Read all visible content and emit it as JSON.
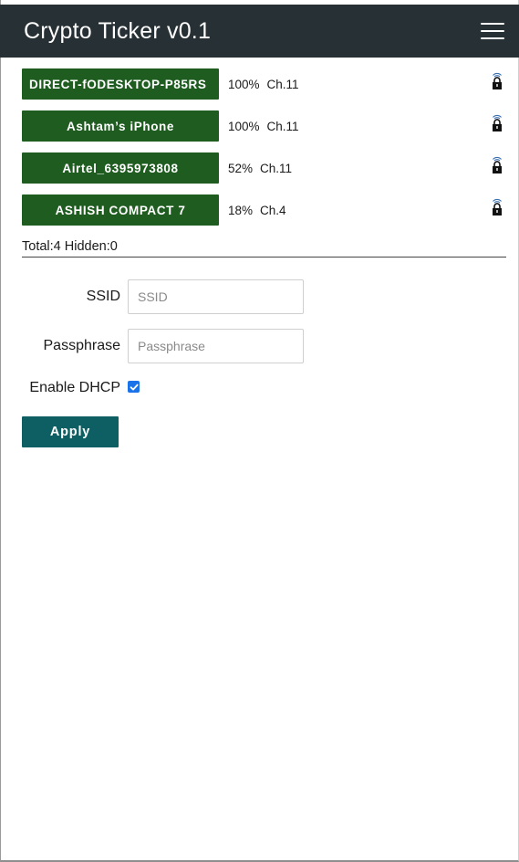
{
  "app": {
    "title": "Crypto Ticker v0.1"
  },
  "networks": [
    {
      "ssid": "DIRECT-fODESKTOP-P85RS",
      "signal": "100%",
      "channel": "Ch.11",
      "secured": true
    },
    {
      "ssid": "Ashtam’s iPhone",
      "signal": "100%",
      "channel": "Ch.11",
      "secured": true
    },
    {
      "ssid": "Airtel_6395973808",
      "signal": "52%",
      "channel": "Ch.11",
      "secured": true
    },
    {
      "ssid": "ASHISH COMPACT 7",
      "signal": "18%",
      "channel": "Ch.4",
      "secured": true
    }
  ],
  "summary": {
    "text": "Total:4 Hidden:0"
  },
  "form": {
    "ssid_label": "SSID",
    "ssid_placeholder": "SSID",
    "ssid_value": "",
    "pass_label": "Passphrase",
    "pass_placeholder": "Passphrase",
    "pass_value": "",
    "dhcp_label": "Enable DHCP",
    "dhcp_checked": true,
    "apply_label": "Apply"
  },
  "colors": {
    "topbar": "#273035",
    "network_button": "#1e5c20",
    "apply_button": "#0d5f63",
    "checkbox": "#1a73e8"
  },
  "icons": {
    "menu": "hamburger-menu-icon",
    "secured": "wifi-lock-icon"
  }
}
